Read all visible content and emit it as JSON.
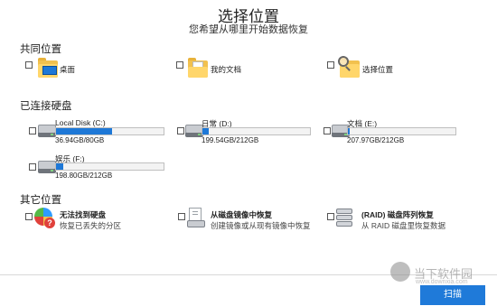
{
  "header": {
    "title": "选择位置",
    "subtitle": "您希望从哪里开始数据恢复"
  },
  "common": {
    "section_title": "共同位置",
    "items": [
      {
        "label": "桌面",
        "icon": "desktop-folder-icon"
      },
      {
        "label": "我的文档",
        "icon": "documents-folder-icon"
      },
      {
        "label": "选择位置",
        "icon": "search-folder-icon"
      }
    ]
  },
  "drives": {
    "section_title": "已连接硬盘",
    "items": [
      {
        "name": "Local Disk (C:)",
        "size": "36.94GB/80GB",
        "used_fraction": 0.52
      },
      {
        "name": "日常 (D:)",
        "size": "199.54GB/212GB",
        "used_fraction": 0.06
      },
      {
        "name": "文档 (E:)",
        "size": "207.97GB/212GB",
        "used_fraction": 0.02
      },
      {
        "name": "娱乐 (F:)",
        "size": "198.80GB/212GB",
        "used_fraction": 0.07
      }
    ]
  },
  "other": {
    "section_title": "其它位置",
    "items": [
      {
        "title": "无法找到硬盘",
        "desc": "恢复已丢失的分区",
        "icon": "lost-partition-icon"
      },
      {
        "title": "从磁盘镜像中恢复",
        "desc": "创建镜像或从现有镜像中恢复",
        "icon": "disk-image-icon"
      },
      {
        "title": "(RAID) 磁盘阵列恢复",
        "desc": "从 RAID 磁盘里恢复数据",
        "icon": "raid-icon"
      }
    ]
  },
  "footer": {
    "scan_label": "扫描"
  },
  "watermark": {
    "text": "当下软件园",
    "url": "www.downxia.com"
  },
  "colors": {
    "accent": "#1e78d7",
    "folder": "#f2c14e"
  }
}
